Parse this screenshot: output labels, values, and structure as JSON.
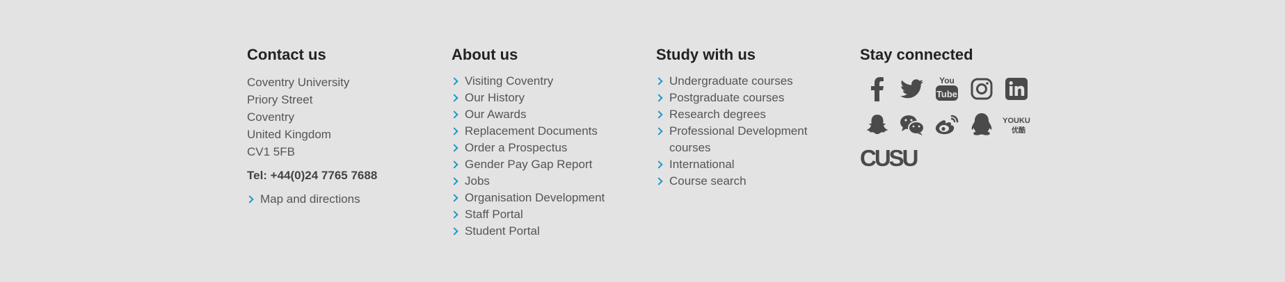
{
  "contact": {
    "heading": "Contact us",
    "address": [
      "Coventry University",
      "Priory Street",
      "Coventry",
      "United Kingdom",
      "CV1 5FB"
    ],
    "tel": "Tel: +44(0)24 7765 7688",
    "map_link": "Map and directions"
  },
  "about": {
    "heading": "About us",
    "links": [
      "Visiting Coventry",
      "Our History",
      "Our Awards",
      "Replacement Documents",
      "Order a Prospectus",
      "Gender Pay Gap Report",
      "Jobs",
      "Organisation Development",
      "Staff Portal",
      "Student Portal"
    ]
  },
  "study": {
    "heading": "Study with us",
    "links": [
      "Undergraduate courses",
      "Postgraduate courses",
      "Research degrees",
      "Professional Development courses",
      "International",
      "Course search"
    ]
  },
  "social": {
    "heading": "Stay connected",
    "icons_row1": [
      "facebook-icon",
      "twitter-icon",
      "youtube-icon",
      "instagram-icon",
      "linkedin-icon"
    ],
    "icons_row2": [
      "snapchat-icon",
      "wechat-icon",
      "weibo-icon",
      "qq-icon",
      "youku-icon"
    ],
    "youtube_text_top": "You",
    "youtube_text_bottom": "Tube",
    "youku_text_top": "YOUKU",
    "youku_text_bottom": "优酷",
    "cusu_text": "CUSU",
    "icon_color": "#4a4a4a",
    "accent_color": "#1a9bc4"
  }
}
